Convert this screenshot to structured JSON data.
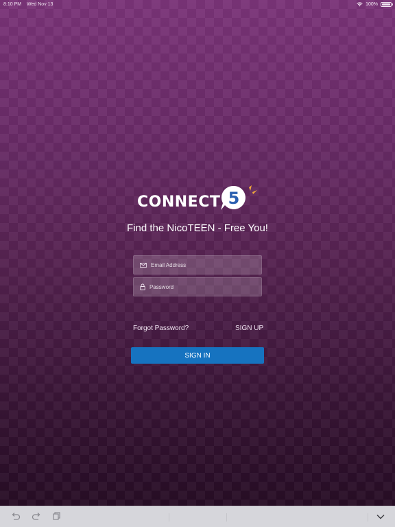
{
  "status_bar": {
    "time": "8:10 PM",
    "date": "Wed Nov 13",
    "battery": "100%"
  },
  "logo": {
    "text": "CONNECT",
    "badge_number": "5",
    "accent_color": "#f2a93b"
  },
  "tagline": "Find the NicoTEEN - Free You!",
  "form": {
    "email_placeholder": "Email Address",
    "password_placeholder": "Password",
    "email_icon": "envelope-icon",
    "password_icon": "lock-icon"
  },
  "links": {
    "forgot_password": "Forgot Password?",
    "sign_up": "SIGN UP"
  },
  "sign_in_label": "SIGN IN",
  "colors": {
    "background_top": "#7a3478",
    "background_bottom": "#230b21",
    "button": "#1673c0"
  },
  "keyboard_bar": {
    "icons": [
      "undo-icon",
      "redo-icon",
      "paste-icon",
      "chevron-down-icon"
    ]
  }
}
